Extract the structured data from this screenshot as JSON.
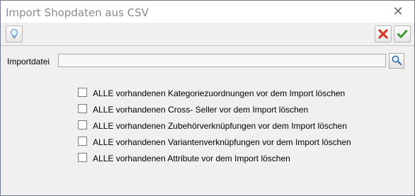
{
  "window": {
    "title": "Import Shopdaten aus CSV",
    "close_glyph": "✕"
  },
  "toolbar": {
    "left_icon": "lightbulb-icon",
    "right_icons": [
      "cancel-icon",
      "confirm-icon"
    ],
    "cancel_color": "#d33a2c",
    "confirm_color": "#3a9a2e"
  },
  "import": {
    "label": "Importdatei",
    "value": "",
    "browse_icon": "magnifier-icon"
  },
  "options": [
    {
      "label": "ALLE vorhandenen Kategoriezuordnungen vor dem Import löschen",
      "checked": false
    },
    {
      "label": "ALLE vorhandenen Cross- Seller vor dem Import löschen",
      "checked": false
    },
    {
      "label": "ALLE vorhandenen Zubehörverknüpfungen vor dem Import löschen",
      "checked": false
    },
    {
      "label": "ALLE vorhandenen Variantenverknüpfungen vor dem Import löschen",
      "checked": false
    },
    {
      "label": "ALLE vorhandenen Attribute vor dem Import löschen",
      "checked": false
    }
  ]
}
